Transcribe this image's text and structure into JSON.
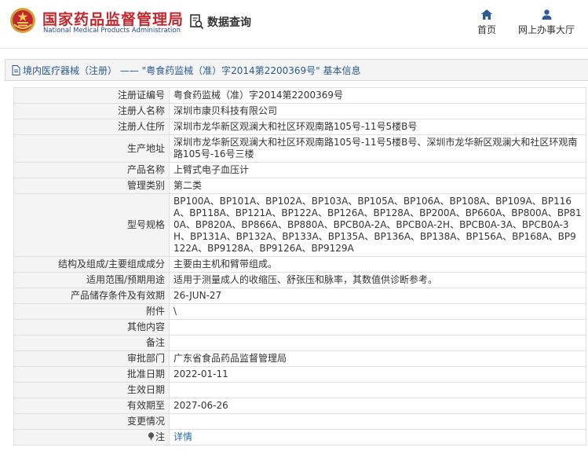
{
  "header": {
    "logo_cn": "国家药品监督管理局",
    "logo_en": "National Medical Products Administration",
    "query_label": "数据查询",
    "nav": [
      {
        "label": "首页",
        "icon": "home-icon"
      },
      {
        "label": "网上办事大厅",
        "icon": "user-icon"
      }
    ]
  },
  "breadcrumb": {
    "title": "境内医疗器械（注册） —— \"粤食药监械（准）字2014第2200369号\" 基本信息"
  },
  "colors": {
    "brand_red": "#c2272d",
    "link_blue": "#2a6bb0",
    "title_blue": "#2a5a8f"
  },
  "detail": {
    "rows": [
      {
        "label": "注册证编号",
        "value": "粤食药监械（准）字2014第2200369号"
      },
      {
        "label": "注册人名称",
        "value": "深圳市康贝科技有限公司"
      },
      {
        "label": "注册人住所",
        "value": "深圳市龙华新区观澜大和社区环观南路105号-11号5楼B号"
      },
      {
        "label": "生产地址",
        "value": "深圳市龙华新区观澜大和社区环观南路105号-11号5楼B号、深圳市龙华新区观澜大和社区环观南路105号-16号三楼"
      },
      {
        "label": "产品名称",
        "value": "上臂式电子血压计"
      },
      {
        "label": "管理类别",
        "value": "第二类"
      },
      {
        "label": "型号规格",
        "value": "BP100A、BP101A、BP102A、BP103A、BP105A、BP106A、BP108A、BP109A、BP116A、BP118A、BP121A、BP122A、BP126A、BP128A、BP200A、BP660A、BP800A、BP810A、BP820A、BP866A、BP880A、BPCB0A-2A、BPCB0A-2H、BPCB0A-3A、BPCB0A-3H、BP131A、BP132A、BP133A、BP135A、BP136A、BP138A、BP156A、BP168A、BP9122A、BP9128A、BP9126A、BP9129A"
      },
      {
        "label": "结构及组成/主要组成成分",
        "value": "主要由主机和臂带组成。"
      },
      {
        "label": "适用范围/预期用途",
        "value": "适用于测量成人的收缩压、舒张压和脉率，其数值供诊断参考。"
      },
      {
        "label": "产品储存条件及有效期",
        "value": "26-JUN-27"
      },
      {
        "label": "附件",
        "value": "\\"
      },
      {
        "label": "其他内容",
        "value": ""
      },
      {
        "label": "备注",
        "value": ""
      },
      {
        "label": "审批部门",
        "value": "广东省食品药品监督管理局"
      },
      {
        "label": "批准日期",
        "value": "2022-01-11"
      },
      {
        "label": "生效日期",
        "value": ""
      },
      {
        "label": "有效期至",
        "value": "2027-06-26"
      },
      {
        "label": "变更情况",
        "value": ""
      },
      {
        "label": "注",
        "value": "详情"
      }
    ]
  }
}
